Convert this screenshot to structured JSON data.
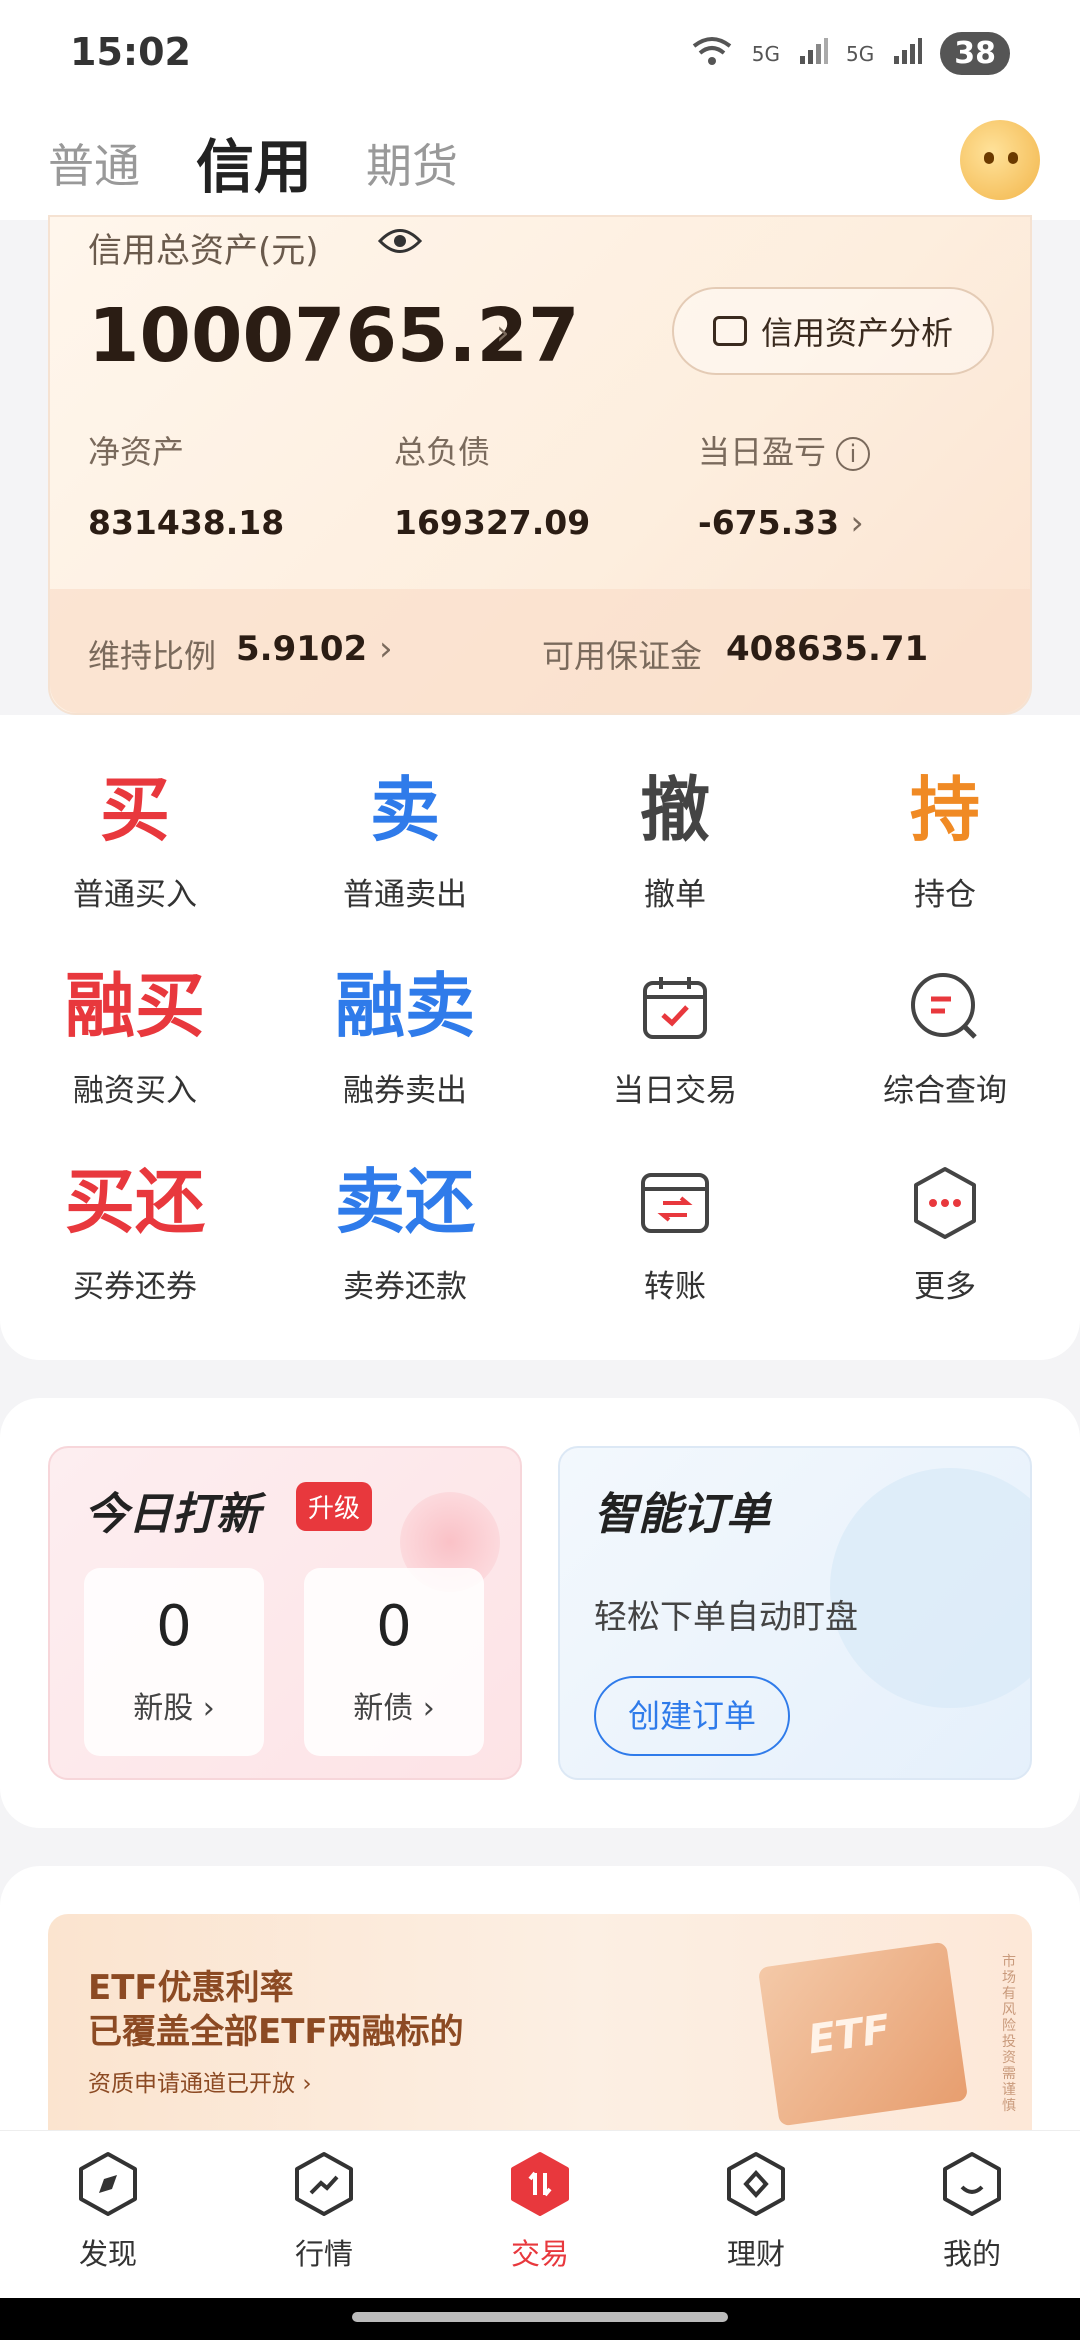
{
  "status_bar": {
    "time": "15:02",
    "network1": "5G",
    "network2": "5G",
    "battery": "38"
  },
  "top_tabs": {
    "tabs": [
      "普通",
      "信用",
      "期货"
    ],
    "active": "信用"
  },
  "asset_card": {
    "label": "信用总资产(元)",
    "total_value": "1000765.27",
    "analysis_button": "信用资产分析",
    "metrics": [
      {
        "label": "净资产",
        "value": "831438.18"
      },
      {
        "label": "总负债",
        "value": "169327.09"
      },
      {
        "label": "当日盈亏",
        "value": "-675.33"
      }
    ],
    "maintenance_label": "维持比例",
    "maintenance_value": "5.9102",
    "margin_label": "可用保证金",
    "margin_value": "408635.71"
  },
  "functions": [
    {
      "glyph": "买",
      "label": "普通买入",
      "color": "#e8383d"
    },
    {
      "glyph": "卖",
      "label": "普通卖出",
      "color": "#2f7bea"
    },
    {
      "glyph": "撤",
      "label": "撤单",
      "color": "#444444"
    },
    {
      "glyph": "持",
      "label": "持仓",
      "color": "#f08a24"
    },
    {
      "glyph": "融买",
      "label": "融资买入",
      "color": "#e8383d"
    },
    {
      "glyph": "融卖",
      "label": "融券卖出",
      "color": "#2f7bea"
    },
    {
      "icon": "calendar-check-icon",
      "label": "当日交易"
    },
    {
      "icon": "search-query-icon",
      "label": "综合查询"
    },
    {
      "glyph": "买还",
      "label": "买券还券",
      "color": "#e8383d"
    },
    {
      "glyph": "卖还",
      "label": "卖券还款",
      "color": "#2f7bea"
    },
    {
      "icon": "transfer-icon",
      "label": "转账"
    },
    {
      "icon": "more-icon",
      "label": "更多"
    }
  ],
  "ipo_card": {
    "title": "今日打新",
    "badge": "升级",
    "items": [
      {
        "count": "0",
        "label": "新股"
      },
      {
        "count": "0",
        "label": "新债"
      }
    ]
  },
  "smart_order_card": {
    "title": "智能订单",
    "subtitle": "轻松下单自动盯盘",
    "button": "创建订单"
  },
  "banner": {
    "line1": "ETF优惠利率",
    "line2": "已覆盖全部ETF两融标的",
    "line3": "资质申请通道已开放",
    "box_text": "ETF",
    "side_text": "市场有风险 投资需谨慎"
  },
  "bottom_nav": {
    "items": [
      {
        "label": "发现",
        "icon": "compass-icon"
      },
      {
        "label": "行情",
        "icon": "trend-icon"
      },
      {
        "label": "交易",
        "icon": "trade-icon"
      },
      {
        "label": "理财",
        "icon": "wealth-icon"
      },
      {
        "label": "我的",
        "icon": "profile-icon"
      }
    ],
    "active": "交易"
  },
  "colors": {
    "accent_red": "#e8383d",
    "accent_blue": "#2f7bea",
    "accent_orange": "#f08a24"
  }
}
